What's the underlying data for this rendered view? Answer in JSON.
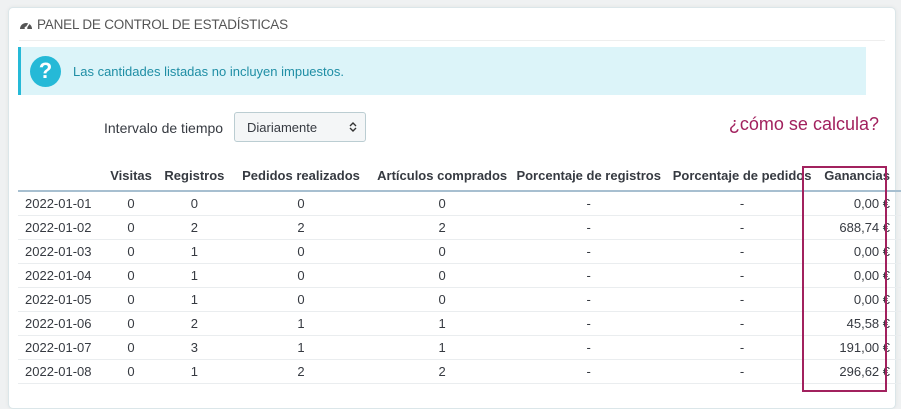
{
  "panel": {
    "title": "PANEL DE CONTROL DE ESTADÍSTICAS",
    "icon": "dashboard-icon"
  },
  "alert": {
    "icon": "question-icon",
    "text": "Las cantidades listadas no incluyen impuestos."
  },
  "filter": {
    "label": "Intervalo de tiempo",
    "selected": "Diariamente"
  },
  "help_link": "¿cómo se calcula?",
  "colors": {
    "accent": "#25b9d7",
    "highlight": "#a2215e",
    "alert_bg": "#dcf4f9"
  },
  "table": {
    "headers": [
      "",
      "Visitas",
      "Registros",
      "Pedidos realizados",
      "Artículos comprados",
      "Porcentaje de registros",
      "Porcentaje de pedidos",
      "Ganancias"
    ],
    "rows": [
      [
        "2022-01-01",
        "0",
        "0",
        "0",
        "0",
        "-",
        "-",
        "0,00 €"
      ],
      [
        "2022-01-02",
        "0",
        "2",
        "2",
        "2",
        "-",
        "-",
        "688,74 €"
      ],
      [
        "2022-01-03",
        "0",
        "1",
        "0",
        "0",
        "-",
        "-",
        "0,00 €"
      ],
      [
        "2022-01-04",
        "0",
        "1",
        "0",
        "0",
        "-",
        "-",
        "0,00 €"
      ],
      [
        "2022-01-05",
        "0",
        "1",
        "0",
        "0",
        "-",
        "-",
        "0,00 €"
      ],
      [
        "2022-01-06",
        "0",
        "2",
        "1",
        "1",
        "-",
        "-",
        "45,58 €"
      ],
      [
        "2022-01-07",
        "0",
        "3",
        "1",
        "1",
        "-",
        "-",
        "191,00 €"
      ],
      [
        "2022-01-08",
        "0",
        "1",
        "2",
        "2",
        "-",
        "-",
        "296,62 €"
      ]
    ]
  }
}
